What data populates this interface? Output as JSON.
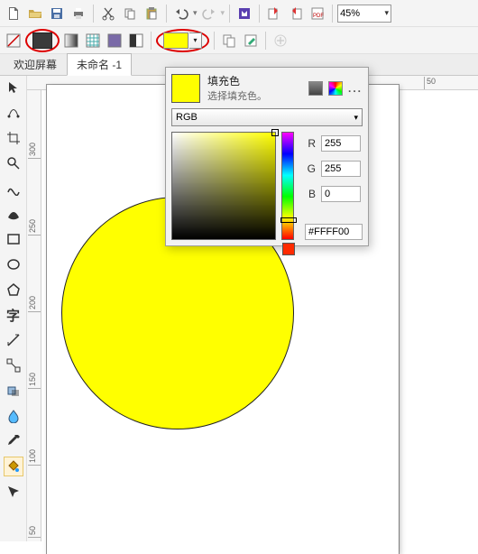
{
  "toolbar": {
    "zoom": "45%",
    "icons": [
      "new",
      "open",
      "save",
      "print",
      "cut",
      "copy",
      "paste",
      "undo",
      "redo",
      "macro",
      "import-a",
      "import-b",
      "export-pdf"
    ]
  },
  "toolbar2": {
    "selected_fill_color": "#FFFF00"
  },
  "tabs": {
    "items": [
      {
        "label": "欢迎屏幕",
        "active": false
      },
      {
        "label": "未命名 -1",
        "active": true
      }
    ]
  },
  "ruler_h": [
    {
      "pos": 300,
      "label": "50"
    }
  ],
  "ruler_v": [
    {
      "pos": 40,
      "label": "300"
    },
    {
      "pos": 125,
      "label": "250"
    },
    {
      "pos": 210,
      "label": "200"
    },
    {
      "pos": 295,
      "label": "150"
    },
    {
      "pos": 380,
      "label": "100"
    },
    {
      "pos": 465,
      "label": "50"
    }
  ],
  "fill_popout": {
    "title": "填充色",
    "subtitle": "选择填充色。",
    "mode": "RGB",
    "r_label": "R",
    "g_label": "G",
    "b_label": "B",
    "r": "255",
    "g": "255",
    "b": "0",
    "hex": "#FFFF00",
    "more": "..."
  },
  "shape": {
    "type": "ellipse",
    "fill": "#FFFF00"
  }
}
